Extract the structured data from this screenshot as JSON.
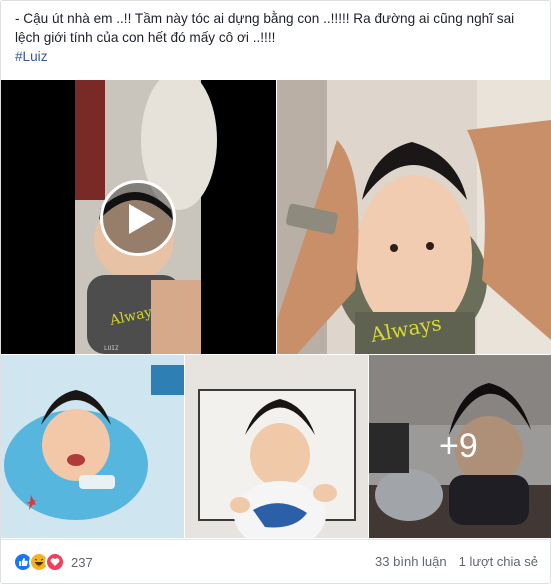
{
  "post": {
    "caption_line1": "- Cậu út nhà em ..!! Tầm này tóc ai dựng bằng con ..!!!!! Ra đường ai cũng nghĩ sai lệch giới tính của con hết đó mấy cô ơi ..!!!!",
    "hashtag": "#Luiz"
  },
  "media": {
    "video_watermark": "LUIZ",
    "more_photos_label": "+9",
    "shirt_print": "Always"
  },
  "footer": {
    "reaction_icons": [
      "like-icon",
      "haha-icon",
      "love-icon"
    ],
    "reaction_count": "237",
    "comments": "33 bình luận",
    "shares": "1 lượt chia sẻ"
  },
  "colors": {
    "like_blue": "#1877f2",
    "haha_yellow": "#f7b125",
    "love_red": "#f33e58",
    "link_blue": "#385898"
  }
}
